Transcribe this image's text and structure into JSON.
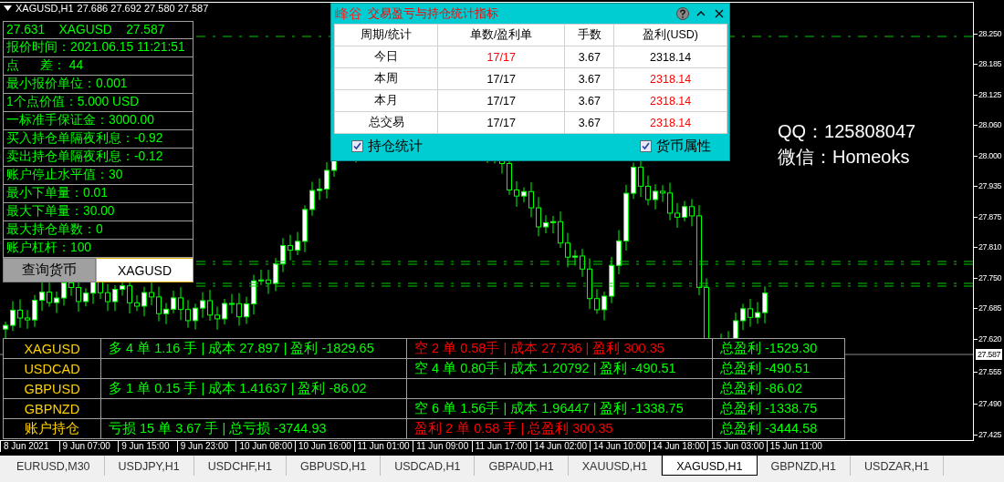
{
  "chart_header": {
    "symbol": "XAGUSD,H1",
    "ohlc": "27.686 27.692 27.580 27.587"
  },
  "info_panel": {
    "rows": [
      "27.631    XAGUSD    27.587",
      "报价时间：2021.06.15 11:21:51",
      "点      差： 44",
      "最小报价单位：0.001",
      "1个点价值：5.000 USD",
      "一标准手保证金：3000.00",
      "买入持仓单隔夜利息：-0.92",
      "卖出持仓单隔夜利息：-0.12",
      "账户停止水平值：30",
      "最小下单量：0.01",
      "最大下单量：30.00",
      "最大持仓单数：0",
      "账户杠杆：100"
    ],
    "query_button": "查询货币",
    "symbol_field": {
      "value": "XAGUSD"
    }
  },
  "stats_dialog": {
    "logo": "峰谷",
    "title": "交易盈亏与持仓统计指标",
    "columns": [
      "周期/统计",
      "单数/盈利单",
      "手数",
      "盈利(USD)"
    ],
    "rows": [
      {
        "cells": [
          {
            "text": "今日",
            "highlighted": false
          },
          {
            "text": "17/17",
            "highlighted": true
          },
          {
            "text": "3.67",
            "highlighted": false
          },
          {
            "text": "2318.14",
            "highlighted": false
          }
        ]
      },
      {
        "cells": [
          {
            "text": "本周",
            "highlighted": false
          },
          {
            "text": "17/17",
            "highlighted": false
          },
          {
            "text": "3.67",
            "highlighted": false
          },
          {
            "text": "2318.14",
            "highlighted": true
          }
        ]
      },
      {
        "cells": [
          {
            "text": "本月",
            "highlighted": false
          },
          {
            "text": "17/17",
            "highlighted": false
          },
          {
            "text": "3.67",
            "highlighted": false
          },
          {
            "text": "2318.14",
            "highlighted": true
          }
        ]
      },
      {
        "cells": [
          {
            "text": "总交易",
            "highlighted": false
          },
          {
            "text": "17/17",
            "highlighted": false
          },
          {
            "text": "3.67",
            "highlighted": false
          },
          {
            "text": "2318.14",
            "highlighted": true
          }
        ]
      }
    ],
    "checkboxes": [
      {
        "label": "持仓统计",
        "checked": true
      },
      {
        "label": "货币属性",
        "checked": true
      }
    ]
  },
  "contact": [
    "QQ：125808047",
    "微信：Homeoks"
  ],
  "positions_table": {
    "rows": [
      {
        "symbol": "XAGUSD",
        "cells": [
          {
            "text": "多 4 单 1.16 手 | 成本 27.897 | 盈利 -1829.65",
            "color": "#00ff00"
          },
          {
            "text": "空 2 单 0.58手 | 成本 27.736 | 盈利 300.35",
            "color": "#ff0000"
          },
          {
            "text": "总盈利 -1529.30",
            "color": "#00ff00"
          }
        ]
      },
      {
        "symbol": "USDCAD",
        "cells": [
          null,
          {
            "text": "空 4 单 0.80手 | 成本 1.20792 | 盈利 -490.51",
            "color": "#00ff00"
          },
          {
            "text": "总盈利 -490.51",
            "color": "#00ff00"
          }
        ]
      },
      {
        "symbol": "GBPUSD",
        "cells": [
          {
            "text": "多 1 单 0.15 手 | 成本 1.41637 | 盈利 -86.02",
            "color": "#00ff00"
          },
          null,
          {
            "text": "总盈利 -86.02",
            "color": "#00ff00"
          }
        ]
      },
      {
        "symbol": "GBPNZD",
        "cells": [
          null,
          {
            "text": "空 6 单 1.56手 | 成本 1.96447 | 盈利 -1338.75",
            "color": "#00ff00"
          },
          {
            "text": "总盈利 -1338.75",
            "color": "#00ff00"
          }
        ]
      },
      {
        "symbol": "账户持仓",
        "cells": [
          {
            "text": "亏损 15 单 3.67 手  | 总亏损  -3744.93",
            "color": "#00ff00"
          },
          {
            "text": "盈利 2 单 0.58 手  | 总盈利 300.35",
            "color": "#ff0000"
          },
          {
            "text": "总盈利 -3444.58",
            "color": "#00ff00"
          }
        ]
      }
    ]
  },
  "price_axis": {
    "labels": [
      "28.250",
      "28.185",
      "28.125",
      "28.060",
      "28.000",
      "27.935",
      "27.875",
      "27.810",
      "27.750",
      "27.685",
      "27.620",
      "27.555",
      "27.490",
      "27.425"
    ],
    "current": "27.587"
  },
  "time_axis": {
    "labels": [
      "8 Jun 2021",
      "9 Jun 07:00",
      "9 Jun 15:00",
      "9 Jun 23:00",
      "10 Jun 08:00",
      "10 Jun 16:00",
      "11 Jun 01:00",
      "11 Jun 09:00",
      "11 Jun 17:00",
      "14 Jun 02:00",
      "14 Jun 10:00",
      "14 Jun 18:00",
      "15 Jun 03:00",
      "15 Jun 11:00"
    ]
  },
  "symbol_tabs": [
    {
      "label": "EURUSD,M30",
      "selected": false
    },
    {
      "label": "USDJPY,H1",
      "selected": false
    },
    {
      "label": "USDCHF,H1",
      "selected": false
    },
    {
      "label": "GBPUSD,H1",
      "selected": false
    },
    {
      "label": "USDCAD,H1",
      "selected": false
    },
    {
      "label": "GBPAUD,H1",
      "selected": false
    },
    {
      "label": "XAUUSD,H1",
      "selected": false
    },
    {
      "label": "XAGUSD,H1",
      "selected": true
    },
    {
      "label": "GBPNZD,H1",
      "selected": false
    },
    {
      "label": "USDZAR,H1",
      "selected": false
    }
  ]
}
